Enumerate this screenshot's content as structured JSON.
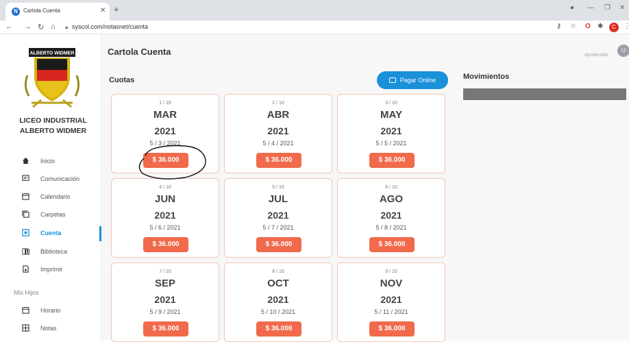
{
  "browser": {
    "tab_title": "Cartola Cuenta",
    "tab_favicon_letter": "N",
    "url": "syscol.com/notasnet/cuenta",
    "avatar_letter": "C"
  },
  "sidebar": {
    "logo_text": "ALBERTO WIDMER",
    "school_name_line1": "LICEO INDUSTRIAL",
    "school_name_line2": "ALBERTO WIDMER",
    "items": [
      {
        "label": "Inicio",
        "icon": "home-icon"
      },
      {
        "label": "Comunicación",
        "icon": "message-icon"
      },
      {
        "label": "Calendario",
        "icon": "calendar-icon"
      },
      {
        "label": "Carpetas",
        "icon": "folders-icon"
      },
      {
        "label": "Cuenta",
        "icon": "account-icon",
        "active": true
      },
      {
        "label": "Biblioteca",
        "icon": "library-icon"
      },
      {
        "label": "Imprimir",
        "icon": "print-icon"
      }
    ],
    "section_label": "Mis Hijos",
    "sub_items": [
      {
        "label": "Horario",
        "icon": "calendar-icon"
      },
      {
        "label": "Notas",
        "icon": "grid-icon"
      }
    ]
  },
  "header": {
    "title": "Cartola Cuenta",
    "user_label": "Apoderado",
    "avatar_letter": "U"
  },
  "cuotas": {
    "title": "Cuotas",
    "pay_button_label": "Pagar Online",
    "cards": [
      {
        "index": "1 / 10",
        "month": "MAR",
        "year": "2021",
        "date": "5 / 3 / 2021",
        "price": "$ 36.000"
      },
      {
        "index": "2 / 10",
        "month": "ABR",
        "year": "2021",
        "date": "5 / 4 / 2021",
        "price": "$ 36.000"
      },
      {
        "index": "3 / 10",
        "month": "MAY",
        "year": "2021",
        "date": "5 / 5 / 2021",
        "price": "$ 36.000"
      },
      {
        "index": "4 / 10",
        "month": "JUN",
        "year": "2021",
        "date": "5 / 6 / 2021",
        "price": "$ 36.000"
      },
      {
        "index": "5 / 10",
        "month": "JUL",
        "year": "2021",
        "date": "5 / 7 / 2021",
        "price": "$ 36.000"
      },
      {
        "index": "6 / 10",
        "month": "AGO",
        "year": "2021",
        "date": "5 / 8 / 2021",
        "price": "$ 36.000"
      },
      {
        "index": "7 / 10",
        "month": "SEP",
        "year": "2021",
        "date": "5 / 9 / 2021",
        "price": "$ 36.000"
      },
      {
        "index": "8 / 10",
        "month": "OCT",
        "year": "2021",
        "date": "5 / 10 / 2021",
        "price": "$ 36.000"
      },
      {
        "index": "9 / 10",
        "month": "NOV",
        "year": "2021",
        "date": "5 / 11 / 2021",
        "price": "$ 36.000"
      }
    ]
  },
  "movimientos": {
    "title": "Movimientos"
  },
  "colors": {
    "accent_blue": "#1a90d9",
    "price_orange": "#f06a4b",
    "card_border": "#f2c4b2"
  }
}
